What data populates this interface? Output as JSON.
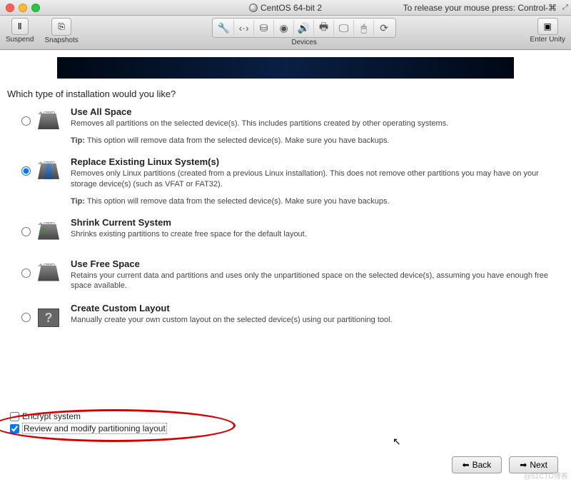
{
  "window": {
    "title": "CentOS 64-bit 2",
    "release_hint": "To release your mouse press: Control-⌘"
  },
  "toolbar": {
    "suspend": "Suspend",
    "snapshots": "Snapshots",
    "devices": "Devices",
    "enter_unity": "Enter Unity"
  },
  "installer": {
    "question": "Which type of installation would you like?",
    "options": [
      {
        "title": "Use All Space",
        "desc": "Removes all partitions on the selected device(s).  This includes partitions created by other operating systems.",
        "tip_label": "Tip:",
        "tip": "This option will remove data from the selected device(s).  Make sure you have backups.",
        "selected": false
      },
      {
        "title": "Replace Existing Linux System(s)",
        "desc": "Removes only Linux partitions (created from a previous Linux installation).  This does not remove other partitions you may have on your storage device(s) (such as VFAT or FAT32).",
        "tip_label": "Tip:",
        "tip": "This option will remove data from the selected device(s).  Make sure you have backups.",
        "selected": true
      },
      {
        "title": "Shrink Current System",
        "desc": "Shrinks existing partitions to create free space for the default layout.",
        "selected": false
      },
      {
        "title": "Use Free Space",
        "desc": "Retains your current data and partitions and uses only the unpartitioned space on the selected device(s), assuming you have enough free space available.",
        "selected": false
      },
      {
        "title": "Create Custom Layout",
        "desc": "Manually create your own custom layout on the selected device(s) using our partitioning tool.",
        "selected": false
      }
    ],
    "os_badge": "OS",
    "encrypt": {
      "label": "Encrypt system",
      "checked": false
    },
    "review": {
      "label": "Review and modify partitioning layout",
      "checked": true
    },
    "back": "Back",
    "next": "Next"
  },
  "watermark": "@51CTO博客"
}
